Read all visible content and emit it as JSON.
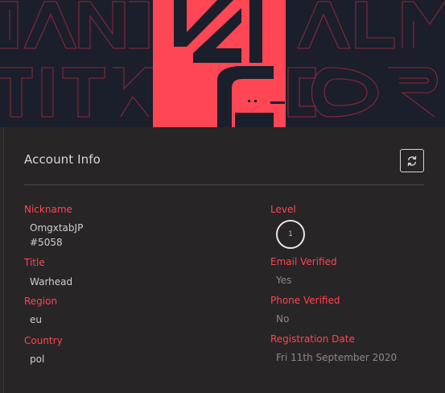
{
  "account": {
    "title": "Account Info",
    "fields_left": [
      {
        "label": "Nickname",
        "value_line1": "OmgxtabJP",
        "value_line2": "#5058"
      },
      {
        "label": "Title",
        "value": "Warhead"
      },
      {
        "label": "Region",
        "value": "eu"
      },
      {
        "label": "Country",
        "value": "pol"
      }
    ],
    "fields_right": [
      {
        "label": "Level",
        "value": "1"
      },
      {
        "label": "Email Verified",
        "value": "Yes"
      },
      {
        "label": "Phone Verified",
        "value": "No"
      },
      {
        "label": "Registration Date",
        "value": "Fri 11th September 2020"
      }
    ]
  },
  "icons": {
    "refresh": "refresh-icon"
  },
  "colors": {
    "accent": "#ff4655",
    "banner_bg": "#1b1e2b",
    "card_bg": "#272525",
    "text": "#d0cece",
    "muted_text": "#8b8989"
  }
}
